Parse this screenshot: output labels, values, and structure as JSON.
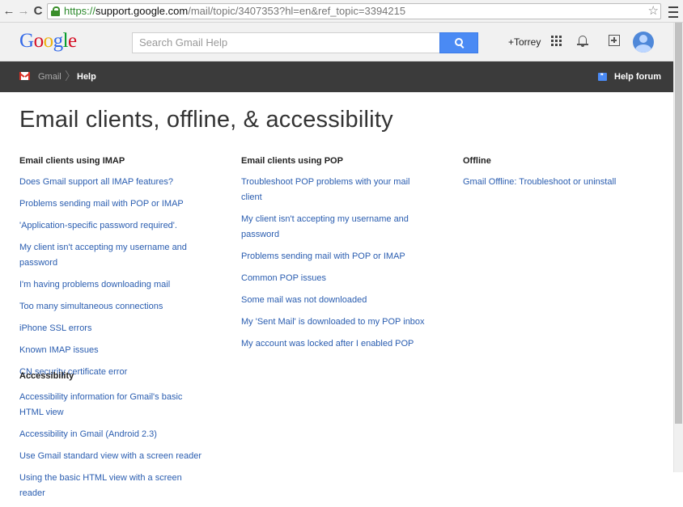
{
  "browser": {
    "url_scheme": "https://",
    "url_host": "support.google.com",
    "url_path": "/mail/topic/3407353?hl=en&ref_topic=3394215"
  },
  "header": {
    "logo_letters": [
      {
        "ch": "G",
        "color": "#3369e8"
      },
      {
        "ch": "o",
        "color": "#d50f25"
      },
      {
        "ch": "o",
        "color": "#eeb211"
      },
      {
        "ch": "g",
        "color": "#3369e8"
      },
      {
        "ch": "l",
        "color": "#009925"
      },
      {
        "ch": "e",
        "color": "#d50f25"
      }
    ],
    "search_placeholder": "Search Gmail Help",
    "user_name": "+Torrey"
  },
  "breadcrumb": {
    "product": "Gmail",
    "separator": "〉",
    "current": "Help"
  },
  "help_forum": {
    "icon_text": "❞",
    "label": "Help forum"
  },
  "page": {
    "title": "Email clients, offline, & accessibility"
  },
  "sections": {
    "imap": {
      "heading": "Email clients using IMAP",
      "links": [
        "Does Gmail support all IMAP features?",
        "Problems sending mail with POP or IMAP",
        "'Application-specific password required'.",
        "My client isn't accepting my username and password",
        "I'm having problems downloading mail",
        "Too many simultaneous connections",
        "iPhone SSL errors",
        "Known IMAP issues",
        "CN security certificate error"
      ]
    },
    "pop": {
      "heading": "Email clients using POP",
      "links": [
        "Troubleshoot POP problems with your mail client",
        "My client isn't accepting my username and password",
        "Problems sending mail with POP or IMAP",
        "Common POP issues",
        "Some mail was not downloaded",
        "My 'Sent Mail' is downloaded to my POP inbox",
        "My account was locked after I enabled POP"
      ]
    },
    "offline": {
      "heading": "Offline",
      "links": [
        "Gmail Offline: Troubleshoot or uninstall"
      ]
    },
    "accessibility": {
      "heading": "Accessibility",
      "links": [
        "Accessibility information for Gmail's basic HTML view",
        "Accessibility in Gmail (Android 2.3)",
        "Use Gmail standard view with a screen reader",
        "Using the basic HTML view with a screen reader"
      ]
    }
  },
  "colors": {
    "link": "#2a5db0",
    "dark_bar": "#3b3b3b",
    "search_button": "#4a8af4"
  },
  "icons": [
    "back-arrow-icon",
    "forward-arrow-icon",
    "reload-icon",
    "lock-icon",
    "star-icon",
    "menu-icon",
    "search-icon",
    "apps-grid-icon",
    "bell-icon",
    "share-plus-icon",
    "avatar-icon",
    "gmail-icon",
    "forum-quote-icon"
  ]
}
